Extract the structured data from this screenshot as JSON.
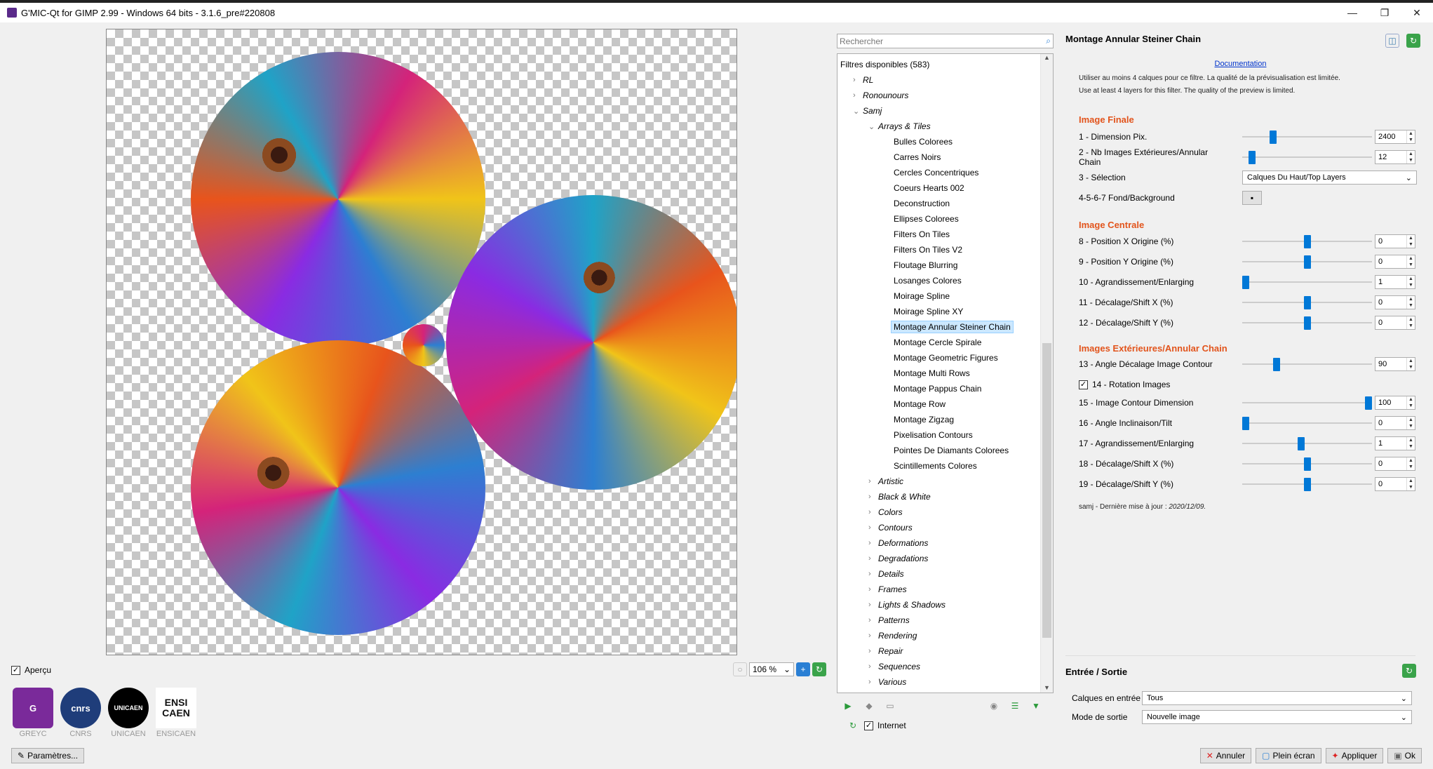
{
  "window": {
    "title": "G'MIC-Qt for GIMP 2.99 - Windows 64 bits - 3.1.6_pre#220808",
    "minimize": "—",
    "restore": "❐",
    "close": "✕"
  },
  "preview": {
    "apercu_label": "Aperçu",
    "zoom_value": "106 %"
  },
  "logos": [
    {
      "name": "GREYC",
      "mark": "G"
    },
    {
      "name": "CNRS",
      "mark": "cnrs"
    },
    {
      "name": "UNICAEN",
      "mark": "UNICAEN"
    },
    {
      "name": "ENSICAEN",
      "mark": "ENSI CAEN"
    }
  ],
  "params_button": "Paramètres...",
  "search": {
    "placeholder": "Rechercher"
  },
  "tree": {
    "header": "Filtres disponibles (583)",
    "top_categories": [
      "RL",
      "Ronounours",
      "Samj"
    ],
    "subcategory": "Arrays & Tiles",
    "filters": [
      "Bulles Colorees",
      "Carres Noirs",
      "Cercles Concentriques",
      "Coeurs Hearts 002",
      "Deconstruction",
      "Ellipses Colorees",
      "Filters On Tiles",
      "Filters On Tiles V2",
      "Floutage Blurring",
      "Losanges Colores",
      "Moirage Spline",
      "Moirage Spline XY",
      "Montage Annular Steiner Chain",
      "Montage Cercle Spirale",
      "Montage Geometric Figures",
      "Montage Multi Rows",
      "Montage Pappus Chain",
      "Montage Row",
      "Montage Zigzag",
      "Pixelisation Contours",
      "Pointes De Diamants Colorees",
      "Scintillements Colores"
    ],
    "selected": "Montage Annular Steiner Chain",
    "more_categories": [
      "Artistic",
      "Black & White",
      "Colors",
      "Contours",
      "Deformations",
      "Degradations",
      "Details",
      "Frames",
      "Lights & Shadows",
      "Patterns",
      "Rendering",
      "Repair",
      "Sequences",
      "Various"
    ],
    "internet_label": "Internet"
  },
  "filter_panel": {
    "title": "Montage Annular Steiner Chain",
    "documentation": "Documentation",
    "note_fr": "Utiliser au moins 4 calques pour ce filtre. La qualité de la prévisualisation est limitée.",
    "note_en": "Use at least 4 layers for this filter. The quality of the preview is limited.",
    "section1": "Image Finale",
    "p1_label": "1 - Dimension Pix.",
    "p1_value": "2400",
    "p1_level": 0.22,
    "p2_label": "2 - Nb Images Extérieures/Annular Chain",
    "p2_value": "12",
    "p2_level": 0.05,
    "p3_label": "3 - Sélection",
    "p3_value": "Calques Du Haut/Top Layers",
    "p4_label": "4-5-6-7 Fond/Background",
    "section2": "Image Centrale",
    "p8_label": "8 - Position X Origine (%)",
    "p8_value": "0",
    "p8_level": 0.5,
    "p9_label": "9 - Position Y Origine (%)",
    "p9_value": "0",
    "p9_level": 0.5,
    "p10_label": "10 - Agrandissement/Enlarging",
    "p10_value": "1",
    "p10_level": 0.0,
    "p11_label": "11 - Décalage/Shift X (%)",
    "p11_value": "0",
    "p11_level": 0.5,
    "p12_label": "12 - Décalage/Shift Y (%)",
    "p12_value": "0",
    "p12_level": 0.5,
    "section3": "Images Extérieures/Annular Chain",
    "p13_label": "13 - Angle Décalage Image Contour",
    "p13_value": "90",
    "p13_level": 0.25,
    "p14_label": "14 - Rotation Images",
    "p14_checked": true,
    "p15_label": "15 - Image Contour Dimension",
    "p15_value": "100",
    "p15_level": 1.0,
    "p16_label": "16 - Angle Inclinaison/Tilt",
    "p16_value": "0",
    "p16_level": 0.0,
    "p17_label": "17 - Agrandissement/Enlarging",
    "p17_value": "1",
    "p17_level": 0.45,
    "p18_label": "18 - Décalage/Shift X (%)",
    "p18_value": "0",
    "p18_level": 0.5,
    "p19_label": "19 - Décalage/Shift Y (%)",
    "p19_value": "0",
    "p19_level": 0.5,
    "footer_prefix": "samj - Dernière mise à jour : ",
    "footer_date": "2020/12/09."
  },
  "io": {
    "title": "Entrée / Sortie",
    "input_label": "Calques en entrée",
    "input_value": "Tous",
    "output_label": "Mode de sortie",
    "output_value": "Nouvelle image"
  },
  "buttons": {
    "cancel": "Annuler",
    "fullscreen": "Plein écran",
    "apply": "Appliquer",
    "ok": "Ok"
  },
  "colors": {
    "accent": "#0078d7",
    "section": "#e2541c",
    "selection": "#cce8ff"
  }
}
